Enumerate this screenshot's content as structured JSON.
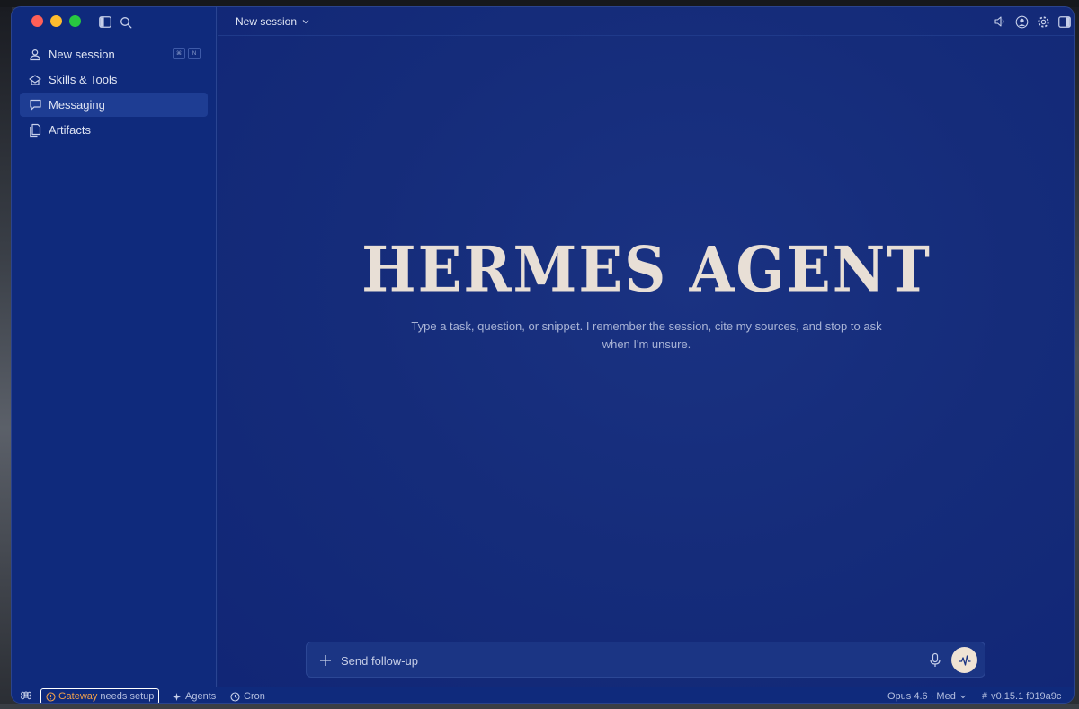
{
  "colors": {
    "sidebar_bg": "#0f2a7c",
    "main_bg": "#152c7a",
    "hero_text": "#e8dfd6",
    "accent_warning": "#f0a04b",
    "send_button": "#efe3d4"
  },
  "sidebar": {
    "items": [
      {
        "label": "New session",
        "icon": "new-session-icon",
        "shortcut": [
          "⌘",
          "N"
        ]
      },
      {
        "label": "Skills & Tools",
        "icon": "skills-tools-icon"
      },
      {
        "label": "Messaging",
        "icon": "chat-bubble-icon",
        "active": true
      },
      {
        "label": "Artifacts",
        "icon": "documents-icon"
      }
    ]
  },
  "header": {
    "session_title": "New session"
  },
  "hero": {
    "title": "HERMES AGENT",
    "subtitle": "Type a task, question, or snippet. I remember the session, cite my sources, and stop to ask when I'm unsure."
  },
  "composer": {
    "placeholder": "Send follow-up"
  },
  "statusbar": {
    "gateway_label": "Gateway",
    "gateway_status": "needs setup",
    "agents_label": "Agents",
    "cron_label": "Cron",
    "model": "Opus 4.6 · Med",
    "version": "v0.15.1 f019a9c"
  }
}
